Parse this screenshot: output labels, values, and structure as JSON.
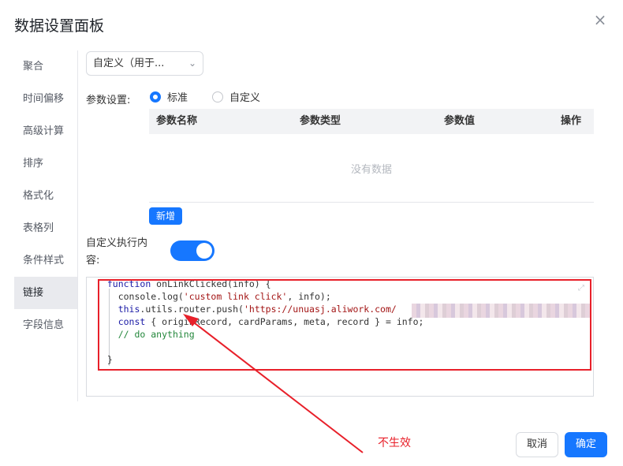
{
  "dialog": {
    "title": "数据设置面板",
    "close_icon": "×"
  },
  "nav": {
    "items": [
      "聚合",
      "时间偏移",
      "高级计算",
      "排序",
      "格式化",
      "表格列",
      "条件样式",
      "链接",
      "字段信息"
    ],
    "active": "链接"
  },
  "select": {
    "value": "自定义（用于...",
    "chevron": "⌄"
  },
  "params": {
    "label": "参数设置:",
    "options": [
      {
        "label": "标准",
        "checked": true
      },
      {
        "label": "自定义",
        "checked": false
      }
    ],
    "columns": [
      "参数名称",
      "参数类型",
      "参数值",
      "操作"
    ],
    "empty_text": "没有数据",
    "add_button": "新增"
  },
  "exec": {
    "label": "自定义执行内容:",
    "toggle_on": true
  },
  "code": {
    "line1_kw": "function",
    "line1_rest": " onLinkClicked(info) {",
    "line2_a": "console.log(",
    "line2_str": "'custom link click'",
    "line2_b": ", info);",
    "line3_kw": "this",
    "line3_a": ".utils.router.push(",
    "line3_str": "'https://unuasj.aliwork.com/",
    "line4_kw": "const",
    "line4_rest": " { originRecord, cardParams, meta, record } = info;",
    "line5_cm": "// do anything",
    "line7": "}",
    "expand_icon": "⤢"
  },
  "annotation": {
    "text": "不生效",
    "color": "#e8202a"
  },
  "footer": {
    "cancel": "取消",
    "ok": "确定"
  },
  "colors": {
    "accent": "#1677ff",
    "annotation_red": "#e8202a"
  }
}
